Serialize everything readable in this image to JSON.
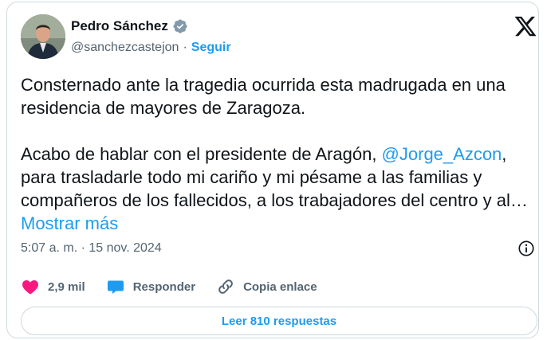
{
  "author": {
    "name": "Pedro Sánchez",
    "handle": "@sanchezcastejon",
    "separator": "·",
    "follow_label": "Seguir",
    "verified_icon": "verified-badge-icon",
    "verified_color": "#829aab"
  },
  "brand": {
    "logo": "x-logo-icon"
  },
  "tweet": {
    "paragraph1": "Consternado ante la tragedia ocurrida esta madrugada en una residencia de mayores de Zaragoza.",
    "paragraph2_before": "Acabo de hablar con el presidente de Aragón, ",
    "mention": "@Jorge_Azcon",
    "paragraph2_after": ", para trasladarle todo mi cariño y mi pésame a las familias y compañeros de los fallecidos, a los trabajadores del centro y al… ",
    "show_more": "Mostrar más",
    "timestamp": "5:07 a. m. · 15 nov. 2024"
  },
  "actions": {
    "likes_count": "2,9 mil",
    "reply_label": "Responder",
    "copy_link_label": "Copia enlace"
  },
  "replies_button": "Leer 810 respuestas",
  "colors": {
    "accent": "#1d9bf0",
    "like": "#f91880",
    "text": "#0f1419",
    "muted": "#536471",
    "border": "#cfd9de"
  }
}
